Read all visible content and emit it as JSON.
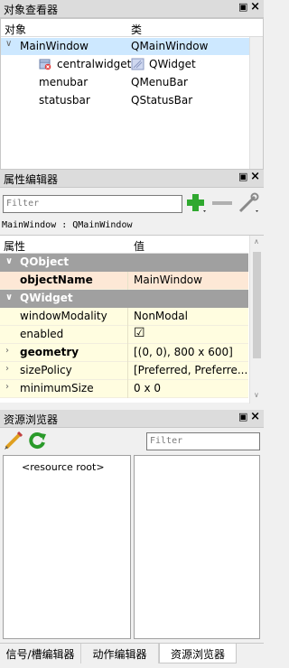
{
  "object_inspector": {
    "title": "对象查看器",
    "columns": [
      "对象",
      "类"
    ],
    "rows": [
      {
        "name": "MainWindow",
        "cls": "QMainWindow",
        "expanded": true,
        "selected": true
      },
      {
        "name": "centralwidget",
        "cls": "QWidget",
        "icon": "widget-icon"
      },
      {
        "name": "menubar",
        "cls": "QMenuBar"
      },
      {
        "name": "statusbar",
        "cls": "QStatusBar"
      }
    ]
  },
  "property_editor": {
    "title": "属性编辑器",
    "filter_placeholder": "Filter",
    "class_label": "MainWindow : QMainWindow",
    "columns": [
      "属性",
      "值"
    ],
    "rows": [
      {
        "type": "group",
        "name": "QObject",
        "expanded": true
      },
      {
        "type": "prop",
        "name": "objectName",
        "value": "MainWindow",
        "bold": true,
        "style": "orange"
      },
      {
        "type": "group",
        "name": "QWidget",
        "expanded": true
      },
      {
        "type": "prop",
        "name": "windowModality",
        "value": "NonModal",
        "style": "yellow"
      },
      {
        "type": "prop",
        "name": "enabled",
        "value": "☑",
        "style": "yellow"
      },
      {
        "type": "prop",
        "name": "geometry",
        "value": "[(0, 0), 800 x 600]",
        "bold": true,
        "style": "yellow",
        "expandable": true
      },
      {
        "type": "prop",
        "name": "sizePolicy",
        "value": "[Preferred, Preferre...",
        "style": "yellow",
        "expandable": true
      },
      {
        "type": "prop",
        "name": "minimumSize",
        "value": "0 x 0",
        "style": "yellow",
        "expandable": true
      }
    ],
    "tool_icons": [
      "add-icon",
      "remove-icon",
      "wrench-icon"
    ]
  },
  "resource_browser": {
    "title": "资源浏览器",
    "filter_placeholder": "Filter",
    "tree_root": "<resource root>",
    "tool_icons": [
      "pencil-icon",
      "reload-icon"
    ]
  },
  "bottom_tabs": [
    {
      "label": "信号/槽编辑器",
      "active": false
    },
    {
      "label": "动作编辑器",
      "active": false
    },
    {
      "label": "资源浏览器",
      "active": true
    }
  ],
  "colors": {
    "selection": "#cde8ff",
    "group_header": "#a0a0a0",
    "prop_yellow": "#fffde0",
    "prop_orange": "#fde8d6",
    "plus_green": "#2fa82f"
  }
}
